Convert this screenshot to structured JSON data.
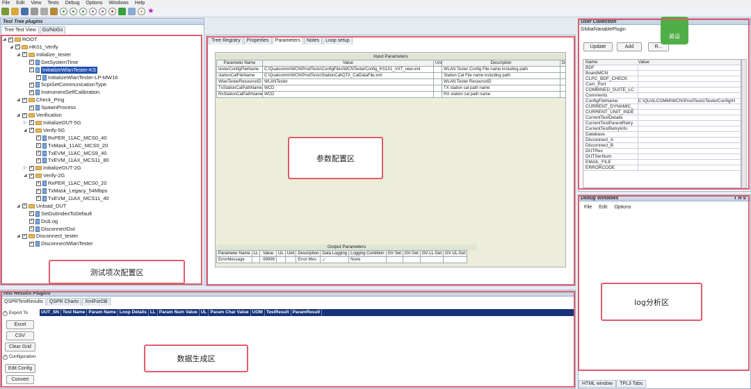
{
  "menu": [
    "File",
    "Edit",
    "View",
    "Tests",
    "Debug",
    "Options",
    "Windows",
    "Help"
  ],
  "test_tree": {
    "title": "Test Tree plugins",
    "tabs": [
      "Tree Test View",
      "Go/NoGo"
    ],
    "nodes": [
      {
        "label": "ROOT",
        "depth": 0,
        "kind": "root"
      },
      {
        "label": "HK01_Verify",
        "depth": 1,
        "kind": "folder"
      },
      {
        "label": "Initialize_tester",
        "depth": 2,
        "kind": "folder"
      },
      {
        "label": "GetSystemTime",
        "depth": 3,
        "kind": "item"
      },
      {
        "label": "InitializeWlanTester-KS",
        "depth": 3,
        "kind": "item",
        "selected": true
      },
      {
        "label": "InitializeWlanTester-LP-MW16",
        "depth": 4,
        "kind": "item"
      },
      {
        "label": "ScpiSetCommunicationType",
        "depth": 3,
        "kind": "item"
      },
      {
        "label": "InstrumentSelfCalibration",
        "depth": 3,
        "kind": "item"
      },
      {
        "label": "Check_Ping",
        "depth": 2,
        "kind": "folder"
      },
      {
        "label": "SpawnProcess",
        "depth": 3,
        "kind": "item"
      },
      {
        "label": "Verification",
        "depth": 2,
        "kind": "folder"
      },
      {
        "label": "InitializeDUT-5G",
        "depth": 3,
        "kind": "folder"
      },
      {
        "label": "Verify-5G",
        "depth": 3,
        "kind": "folder"
      },
      {
        "label": "RxPER_11AC_MCS0_40",
        "depth": 4,
        "kind": "item"
      },
      {
        "label": "TxMask_11AC_MCS0_20",
        "depth": 4,
        "kind": "item"
      },
      {
        "label": "TxEVM_11AC_MCS9_40",
        "depth": 4,
        "kind": "item"
      },
      {
        "label": "TxEVM_11AX_MCS11_80",
        "depth": 4,
        "kind": "item"
      },
      {
        "label": "InitializeDUT-2G",
        "depth": 3,
        "kind": "folder"
      },
      {
        "label": "Verify-2G",
        "depth": 3,
        "kind": "folder"
      },
      {
        "label": "RxPER_11AC_MCS0_20",
        "depth": 4,
        "kind": "item"
      },
      {
        "label": "TxMask_Legacy_54Mbps",
        "depth": 4,
        "kind": "item"
      },
      {
        "label": "TxEVM_11AX_MCS11_40",
        "depth": 4,
        "kind": "item"
      },
      {
        "label": "Unload_DUT",
        "depth": 2,
        "kind": "folder"
      },
      {
        "label": "SetDutIndexToDefault",
        "depth": 3,
        "kind": "item"
      },
      {
        "label": "DutLog",
        "depth": 3,
        "kind": "item"
      },
      {
        "label": "DisconnectDut",
        "depth": 3,
        "kind": "item"
      },
      {
        "label": "Disconnect_tester",
        "depth": 2,
        "kind": "folder"
      },
      {
        "label": "DisconnectWlanTester",
        "depth": 3,
        "kind": "item"
      }
    ],
    "callout": "测试项次配置区"
  },
  "center": {
    "tabs": [
      "Tree Registry",
      "Properties",
      "Parameters",
      "Notes",
      "Loop setup"
    ],
    "input_title": "Input Parameters",
    "input_headers": [
      "Parameter Name",
      "Value",
      "Unit",
      "Description",
      "Deta"
    ],
    "input_rows": [
      [
        "testerConfigFileName",
        "C:\\Qualcomm\\WCN\\ProdTests\\ConfigFiles\\WCNTesterConfig_KS1X1_VXT_new.xml",
        "",
        "WLAN Tester Config File name including path",
        ""
      ],
      [
        "stationCalFileName",
        "C:\\Qualcomm\\WCN\\ProdTests\\StationCal\\QTA_CalDataFile.xml",
        "",
        "Station Cal File name including path",
        ""
      ],
      [
        "WlanTesterResourceID",
        "WLANTester",
        "",
        "WLAN Tester ResourceID",
        ""
      ],
      [
        "TxStationCalPathName",
        "WCD",
        "",
        "TX station cal path name",
        ""
      ],
      [
        "RxStationCalPathName",
        "WCD",
        "",
        "RX station cal path name",
        ""
      ]
    ],
    "output_title": "Output Parameters",
    "output_headers": [
      "Parameter Name",
      "LL",
      "Value",
      "UL",
      "Unit",
      "Description",
      "Data Logging",
      "Logging Condition",
      "GV Set",
      "GV Get",
      "GV LL Get",
      "GV UL Get"
    ],
    "output_rows": [
      [
        "ErrorMessage",
        "",
        "-99999",
        "",
        "",
        "Error Mes",
        "✓",
        "None",
        "",
        "",
        "",
        ""
      ]
    ],
    "callout": "参数配置区"
  },
  "results": {
    "title": "Test Results Plugins",
    "tabs": [
      "QSPRTestResults",
      "QSPR Charts",
      "XmlForDB"
    ],
    "export_label": "Export To",
    "buttons": [
      "Excel",
      "CSV",
      "Clear Grid"
    ],
    "config_label": "Configuration",
    "config_buttons": [
      "Edit Config",
      "Convert"
    ],
    "columns": [
      "UUT_SN",
      "Test Name",
      "Param Name",
      "Loop Details",
      "LL",
      "Param Num Value",
      "UL",
      "Param Char Value",
      "UOM",
      "TestResult",
      "ParamResult"
    ],
    "callout": "数据生成区"
  },
  "user_collection": {
    "title": "User Collection",
    "tab": "GlobalVariablePlugin",
    "buttons": [
      "Update",
      "Add",
      "R..."
    ],
    "headers": [
      "Name",
      "Value"
    ],
    "rows": [
      [
        "BDF",
        ""
      ],
      [
        "BoardMCN",
        ""
      ],
      [
        "CLPC_BDF_CHECK",
        ""
      ],
      [
        "Com_Port",
        ""
      ],
      [
        "COMBINED_SUITE_LC",
        ""
      ],
      [
        "Comments",
        ""
      ],
      [
        "ConfigFileName",
        "C:\\QUALCOMM\\WCN\\ProdTests\\TesterConfig\\H"
      ],
      [
        "CURRENT_DYNAMIC_",
        ""
      ],
      [
        "CURRENT_UNIT_INDE",
        ""
      ],
      [
        "CurrentTestDetails",
        ""
      ],
      [
        "CurrentTestParentRetry",
        ""
      ],
      [
        "CurrentTestRetryInfo",
        ""
      ],
      [
        "Database",
        ""
      ],
      [
        "Disconnect_A",
        ""
      ],
      [
        "Disconnect_B",
        ""
      ],
      [
        "DUTRev",
        ""
      ],
      [
        "DUTSerNum",
        ""
      ],
      [
        "EMAIL_FILE",
        ""
      ],
      [
        "ERRORCODE",
        ""
      ]
    ]
  },
  "debug": {
    "title": "Debug Windows",
    "controls": "T H V",
    "menu": [
      "File",
      "Edit",
      "Options"
    ],
    "tabs": [
      "HTML window",
      "TPL3 Tabs"
    ],
    "callout": "log分析区"
  },
  "watermark": "英设"
}
